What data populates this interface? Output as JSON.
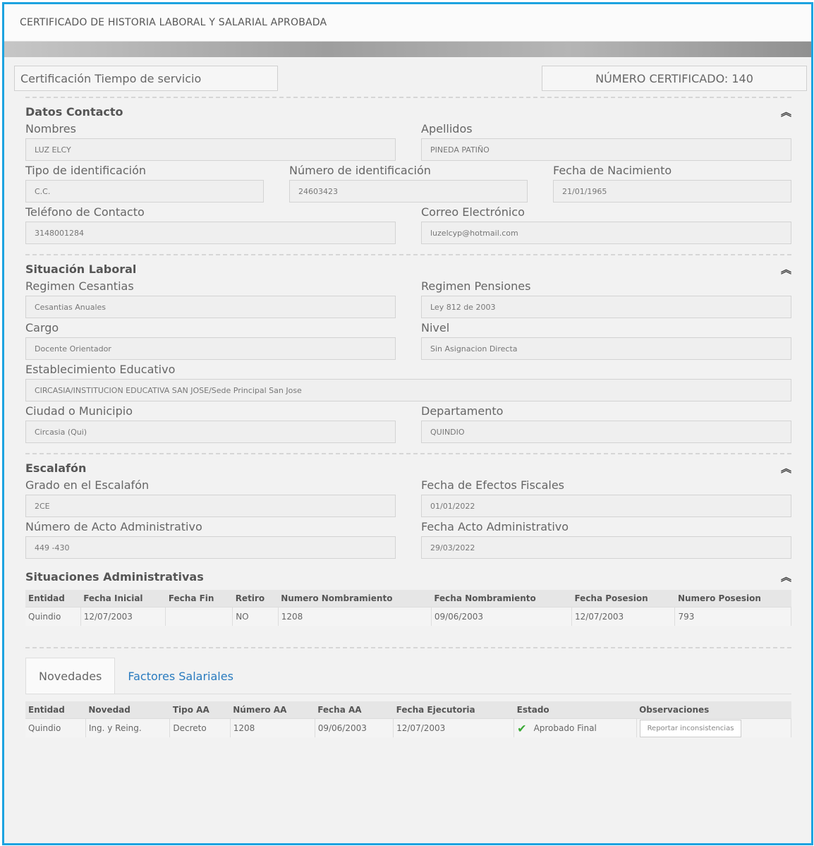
{
  "title": "CERTIFICADO DE HISTORIA LABORAL Y SALARIAL APROBADA",
  "top": {
    "tipo": "Certificación Tiempo de servicio",
    "numero": "NÚMERO CERTIFICADO: 140"
  },
  "contacto": {
    "title": "Datos Contacto",
    "nombres_label": "Nombres",
    "nombres": "LUZ ELCY",
    "apellidos_label": "Apellidos",
    "apellidos": "PINEDA PATIÑO",
    "tipo_id_label": "Tipo de identificación",
    "tipo_id": "C.C.",
    "num_id_label": "Número de identificación",
    "num_id": "24603423",
    "fecha_nac_label": "Fecha de Nacimiento",
    "fecha_nac": "21/01/1965",
    "telefono_label": "Teléfono de Contacto",
    "telefono": "3148001284",
    "correo_label": "Correo Electrónico",
    "correo": "luzelcyp@hotmail.com"
  },
  "laboral": {
    "title": "Situación Laboral",
    "cesantias_label": "Regimen Cesantias",
    "cesantias": "Cesantias Anuales",
    "pensiones_label": "Regimen Pensiones",
    "pensiones": "Ley 812 de 2003",
    "cargo_label": "Cargo",
    "cargo": "Docente Orientador",
    "nivel_label": "Nivel",
    "nivel": "Sin Asignacion Directa",
    "establecimiento_label": "Establecimiento Educativo",
    "establecimiento": "CIRCASIA/INSTITUCION EDUCATIVA SAN JOSE/Sede Principal San Jose",
    "ciudad_label": "Ciudad o Municipio",
    "ciudad": "Circasia (Qui)",
    "departamento_label": "Departamento",
    "departamento": "QUINDIO"
  },
  "escalafon": {
    "title": "Escalafón",
    "grado_label": "Grado en el Escalafón",
    "grado": "2CE",
    "efectos_label": "Fecha de Efectos Fiscales",
    "efectos": "01/01/2022",
    "acto_label": "Número de Acto Administrativo",
    "acto": "449 -430",
    "fecha_acto_label": "Fecha Acto Administrativo",
    "fecha_acto": "29/03/2022"
  },
  "administrativas": {
    "title": "Situaciones Administrativas",
    "headers": [
      "Entidad",
      "Fecha Inicial",
      "Fecha Fin",
      "Retiro",
      "Numero Nombramiento",
      "Fecha Nombramiento",
      "Fecha Posesion",
      "Numero Posesion"
    ],
    "row": [
      "Quindio",
      "12/07/2003",
      "",
      "NO",
      "1208",
      "09/06/2003",
      "12/07/2003",
      "793"
    ]
  },
  "tabs": [
    "Novedades",
    "Factores Salariales"
  ],
  "novedades": {
    "headers": [
      "Entidad",
      "Novedad",
      "Tipo AA",
      "Número AA",
      "Fecha AA",
      "Fecha Ejecutoria",
      "Estado",
      "Observaciones"
    ],
    "row": {
      "entidad": "Quindio",
      "novedad": "Ing. y Reing.",
      "tipo": "Decreto",
      "numero": "1208",
      "fecha": "09/06/2003",
      "ejecutoria": "12/07/2003",
      "estado": "Aprobado Final",
      "boton": "Reportar inconsistencias"
    }
  },
  "icons": {
    "collapse": "double-chevron-up-icon",
    "estado": "check-icon"
  },
  "colors": {
    "border": "#1da3e0",
    "link": "#2a7bbf",
    "check": "#3aa935"
  }
}
